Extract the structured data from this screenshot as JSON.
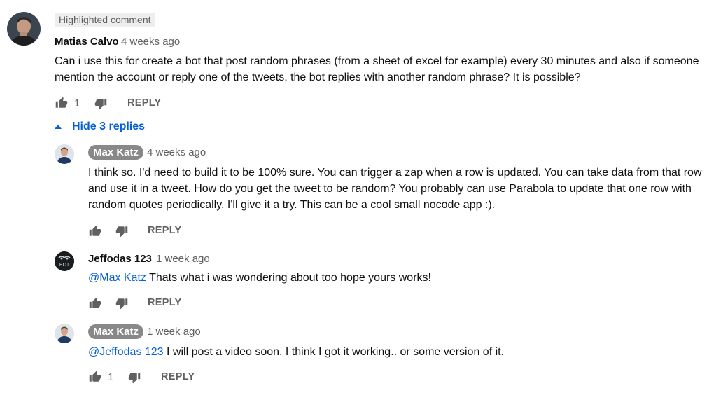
{
  "main_comment": {
    "badge": "Highlighted comment",
    "author": "Matias Calvo",
    "time": "4 weeks ago",
    "text": "Can i use this for create a bot that post random phrases (from a sheet of excel for example) every 30 minutes and also if someone mention the account or reply one of the tweets, the bot replies with another random phrase? It is possible?",
    "likes": "1",
    "reply_label": "REPLY"
  },
  "replies_toggle": "Hide 3 replies",
  "replies": [
    {
      "author": "Max Katz",
      "time": "4 weeks ago",
      "text": "I think so. I'd need to build it to be 100% sure. You can trigger a zap when a row is updated. You can take data from that row and use it in a tweet. How do you get the tweet to be random? You probably can use Parabola to update that one row with random quotes periodically. I'll give it a try. This can be a cool small nocode app :).",
      "reply_label": "REPLY"
    },
    {
      "author": "Jeffodas 123",
      "time": "1 week ago",
      "avatar_text": "BOT",
      "mention": "@Max Katz",
      "text": "Thats what i was wondering about too hope yours works!",
      "reply_label": "REPLY"
    },
    {
      "author": "Max Katz",
      "time": "1 week ago",
      "mention": "@Jeffodas 123",
      "text": "I will post a video soon. I think I got it working.. or some version of it.",
      "likes": "1",
      "reply_label": "REPLY"
    }
  ]
}
